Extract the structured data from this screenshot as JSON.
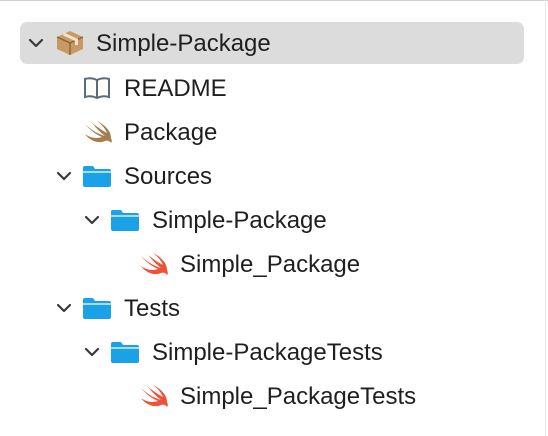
{
  "navigator": {
    "root": {
      "label": "Simple-Package",
      "icon": "package-box-icon",
      "expanded": true,
      "selected": true
    },
    "readme": {
      "label": "README",
      "icon": "book-icon"
    },
    "package": {
      "label": "Package",
      "icon": "swift-icon"
    },
    "sources": {
      "label": "Sources",
      "icon": "folder-icon",
      "expanded": true,
      "simple_package": {
        "label": "Simple-Package",
        "icon": "folder-icon",
        "expanded": true,
        "file": {
          "label": "Simple_Package",
          "icon": "swift-icon"
        }
      }
    },
    "tests": {
      "label": "Tests",
      "icon": "folder-icon",
      "expanded": true,
      "simple_package_tests": {
        "label": "Simple-PackageTests",
        "icon": "folder-icon",
        "expanded": true,
        "file": {
          "label": "Simple_PackageTests",
          "icon": "swift-icon"
        }
      }
    }
  },
  "colors": {
    "selection": "#dcdcdc",
    "folder": "#1aa1e8",
    "swift_orange": "#f05138",
    "swift_brown": "#a57d4f",
    "package_box": "#b98a55",
    "chevron": "#3a3a3a",
    "text": "#1f1f1f"
  }
}
